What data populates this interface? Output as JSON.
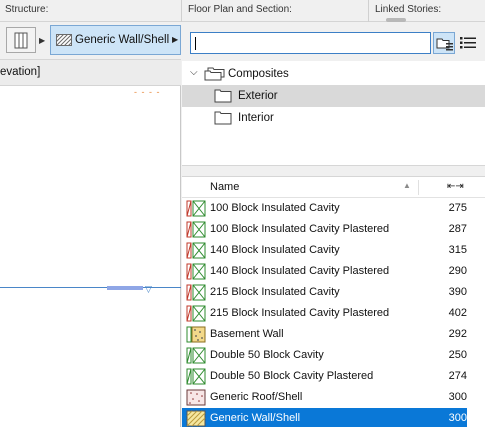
{
  "header": {
    "structure_label": "Structure:",
    "floorplan_label": "Floor Plan and Section:",
    "linked_label": "Linked Stories:"
  },
  "left": {
    "structure_type_icon": "basic-wall-icon",
    "selected_composite": "Generic Wall/Shell",
    "elevation_label": "evation]",
    "dash_marker": "- - - -"
  },
  "search": {
    "value": "",
    "placeholder": ""
  },
  "tree": [
    {
      "label": "Composites",
      "expanded": true
    },
    {
      "label": "Exterior",
      "selected": true
    },
    {
      "label": "Interior",
      "selected": false
    }
  ],
  "list": {
    "header_name": "Name",
    "header_thickness_icon": "thickness-icon",
    "header_thickness": "⇤⇥",
    "rows": [
      {
        "name": "100 Block Insulated Cavity",
        "thickness": "275",
        "swatch": "red-x"
      },
      {
        "name": "100 Block Insulated Cavity Plastered",
        "thickness": "287",
        "swatch": "red-x"
      },
      {
        "name": "140 Block Insulated Cavity",
        "thickness": "315",
        "swatch": "red-x"
      },
      {
        "name": "140 Block Insulated Cavity Plastered",
        "thickness": "290",
        "swatch": "red-x"
      },
      {
        "name": "215 Block Insulated Cavity",
        "thickness": "390",
        "swatch": "red-x"
      },
      {
        "name": "215 Block Insulated Cavity Plastered",
        "thickness": "402",
        "swatch": "red-x"
      },
      {
        "name": "Basement Wall",
        "thickness": "292",
        "swatch": "yellow-dots"
      },
      {
        "name": "Double 50 Block Cavity",
        "thickness": "250",
        "swatch": "green-x"
      },
      {
        "name": "Double 50 Block Cavity Plastered",
        "thickness": "274",
        "swatch": "green-x"
      },
      {
        "name": "Generic Roof/Shell",
        "thickness": "300",
        "swatch": "red-dots"
      },
      {
        "name": "Generic Wall/Shell",
        "thickness": "300",
        "swatch": "yellow-hatch",
        "selected": true
      }
    ]
  },
  "colors": {
    "accent": "#0a78d7",
    "selected_button_bg": "#cde4f7",
    "tree_selected_bg": "#d9d9d9",
    "dash_marker": "#e7883b",
    "plan_line": "#4a86c8"
  }
}
